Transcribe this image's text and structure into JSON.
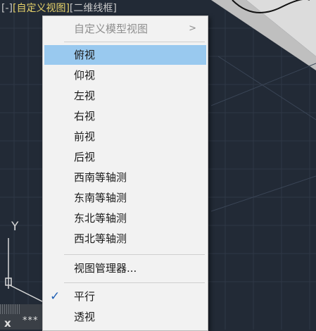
{
  "viewport": {
    "label_ctl": "[-]",
    "label_view": "[自定义视图]",
    "label_style": "[二维线框]",
    "ucs_axis_y": "Y"
  },
  "command_line": {
    "close_glyph": "x",
    "prompt": "***"
  },
  "menu": {
    "submenu_header": "自定义模型视图",
    "views": [
      "俯视",
      "仰视",
      "左视",
      "右视",
      "前视",
      "后视",
      "西南等轴测",
      "东南等轴测",
      "东北等轴测",
      "西北等轴测"
    ],
    "highlighted_view": "俯视",
    "view_manager": "视图管理器...",
    "projection": [
      "平行",
      "透视"
    ],
    "checked_projection": "平行"
  },
  "colors": {
    "background": "#222a36",
    "view_label": "#e6d26a",
    "menu_bg": "#f2f2f2",
    "highlight": "#99c9ef",
    "check": "#1f5fb4"
  }
}
